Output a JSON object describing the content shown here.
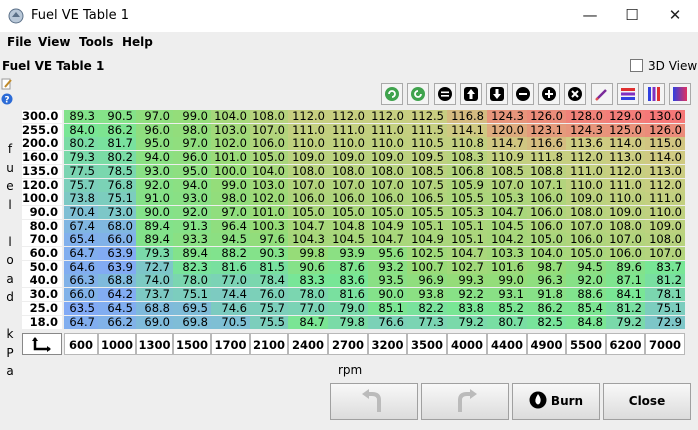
{
  "window": {
    "title": "Fuel VE Table 1"
  },
  "menu": [
    "File",
    "View",
    "Tools",
    "Help"
  ],
  "panel": {
    "title": "Fuel VE Table 1",
    "view3d_label": "3D View",
    "view3d_checked": false
  },
  "toolbar": [
    "refresh-icon",
    "refresh-alt-icon",
    "equals-icon",
    "arrow-up-icon",
    "arrow-down-icon",
    "minus-icon",
    "plus-icon",
    "multiply-icon",
    "pencil-icon",
    "color-bars-horizontal-icon",
    "color-bars-vertical-icon",
    "gradient-icon"
  ],
  "y_axis_label": "fuel load kPa",
  "x_axis_label": "rpm",
  "table": {
    "rpm": [
      "600",
      "1000",
      "1300",
      "1500",
      "1700",
      "2100",
      "2400",
      "2700",
      "3200",
      "3500",
      "4000",
      "4400",
      "4900",
      "5500",
      "6200",
      "7000"
    ],
    "kpa": [
      "300.0",
      "255.0",
      "200.0",
      "160.0",
      "135.0",
      "120.0",
      "100.0",
      "90.0",
      "80.0",
      "70.0",
      "60.0",
      "50.0",
      "40.0",
      "30.0",
      "25.0",
      "18.0"
    ],
    "values": [
      [
        "89.3",
        "90.5",
        "97.0",
        "99.0",
        "104.0",
        "108.0",
        "112.0",
        "112.0",
        "112.0",
        "112.5",
        "116.8",
        "124.3",
        "126.0",
        "128.0",
        "129.0",
        "130.0"
      ],
      [
        "84.0",
        "86.2",
        "96.0",
        "98.0",
        "103.0",
        "107.0",
        "111.0",
        "111.0",
        "111.0",
        "111.5",
        "114.1",
        "120.0",
        "123.1",
        "124.3",
        "125.0",
        "126.0"
      ],
      [
        "80.2",
        "81.7",
        "95.0",
        "97.0",
        "102.0",
        "106.0",
        "110.0",
        "110.0",
        "110.0",
        "110.5",
        "110.8",
        "114.7",
        "116.6",
        "113.6",
        "114.0",
        "115.0"
      ],
      [
        "79.3",
        "80.2",
        "94.0",
        "96.0",
        "101.0",
        "105.0",
        "109.0",
        "109.0",
        "109.0",
        "109.5",
        "108.3",
        "110.9",
        "111.8",
        "112.0",
        "113.0",
        "114.0"
      ],
      [
        "77.5",
        "78.5",
        "93.0",
        "95.0",
        "100.0",
        "104.0",
        "108.0",
        "108.0",
        "108.0",
        "108.5",
        "106.8",
        "108.5",
        "108.8",
        "111.0",
        "112.0",
        "113.0"
      ],
      [
        "75.7",
        "76.8",
        "92.0",
        "94.0",
        "99.0",
        "103.0",
        "107.0",
        "107.0",
        "107.0",
        "107.5",
        "105.9",
        "107.0",
        "107.1",
        "110.0",
        "111.0",
        "112.0"
      ],
      [
        "73.8",
        "75.1",
        "91.0",
        "93.0",
        "98.0",
        "102.0",
        "106.0",
        "106.0",
        "106.0",
        "106.5",
        "105.5",
        "105.3",
        "106.0",
        "109.0",
        "110.0",
        "111.0"
      ],
      [
        "70.4",
        "73.0",
        "90.0",
        "92.0",
        "97.0",
        "101.0",
        "105.0",
        "105.0",
        "105.0",
        "105.5",
        "105.3",
        "104.7",
        "106.0",
        "108.0",
        "109.0",
        "110.0"
      ],
      [
        "67.4",
        "68.0",
        "89.4",
        "91.3",
        "96.4",
        "100.3",
        "104.7",
        "104.8",
        "104.9",
        "105.1",
        "105.1",
        "104.5",
        "106.0",
        "107.0",
        "108.0",
        "109.0"
      ],
      [
        "65.4",
        "66.0",
        "89.4",
        "93.3",
        "94.5",
        "97.6",
        "104.3",
        "104.5",
        "104.7",
        "104.9",
        "105.1",
        "104.2",
        "105.0",
        "106.0",
        "107.0",
        "108.0"
      ],
      [
        "64.7",
        "63.9",
        "79.3",
        "89.4",
        "88.2",
        "90.3",
        "99.8",
        "93.9",
        "95.6",
        "102.5",
        "104.7",
        "103.3",
        "104.0",
        "105.0",
        "106.0",
        "107.0"
      ],
      [
        "64.6",
        "63.9",
        "72.7",
        "82.3",
        "81.6",
        "81.5",
        "90.6",
        "87.6",
        "93.2",
        "100.7",
        "102.7",
        "101.6",
        "98.7",
        "94.5",
        "89.6",
        "83.7"
      ],
      [
        "66.3",
        "68.8",
        "74.0",
        "78.0",
        "77.0",
        "78.4",
        "83.3",
        "83.6",
        "93.5",
        "96.9",
        "99.3",
        "99.0",
        "96.3",
        "92.0",
        "87.1",
        "81.2"
      ],
      [
        "66.0",
        "64.2",
        "73.7",
        "75.1",
        "74.4",
        "76.0",
        "78.0",
        "81.6",
        "90.0",
        "93.8",
        "92.2",
        "93.1",
        "91.8",
        "88.6",
        "84.1",
        "78.1"
      ],
      [
        "63.5",
        "64.5",
        "68.8",
        "69.5",
        "74.6",
        "75.7",
        "77.0",
        "79.0",
        "85.1",
        "82.2",
        "83.8",
        "85.2",
        "86.2",
        "85.4",
        "81.2",
        "75.1"
      ],
      [
        "64.7",
        "66.2",
        "69.0",
        "69.8",
        "70.5",
        "75.5",
        "84.7",
        "79.8",
        "76.6",
        "77.3",
        "79.2",
        "80.7",
        "82.5",
        "84.8",
        "79.2",
        "72.9"
      ]
    ],
    "scale": {
      "min": 63.5,
      "max": 130.0
    }
  },
  "buttons": {
    "undo": "",
    "redo": "",
    "burn": "Burn",
    "close": "Close"
  }
}
